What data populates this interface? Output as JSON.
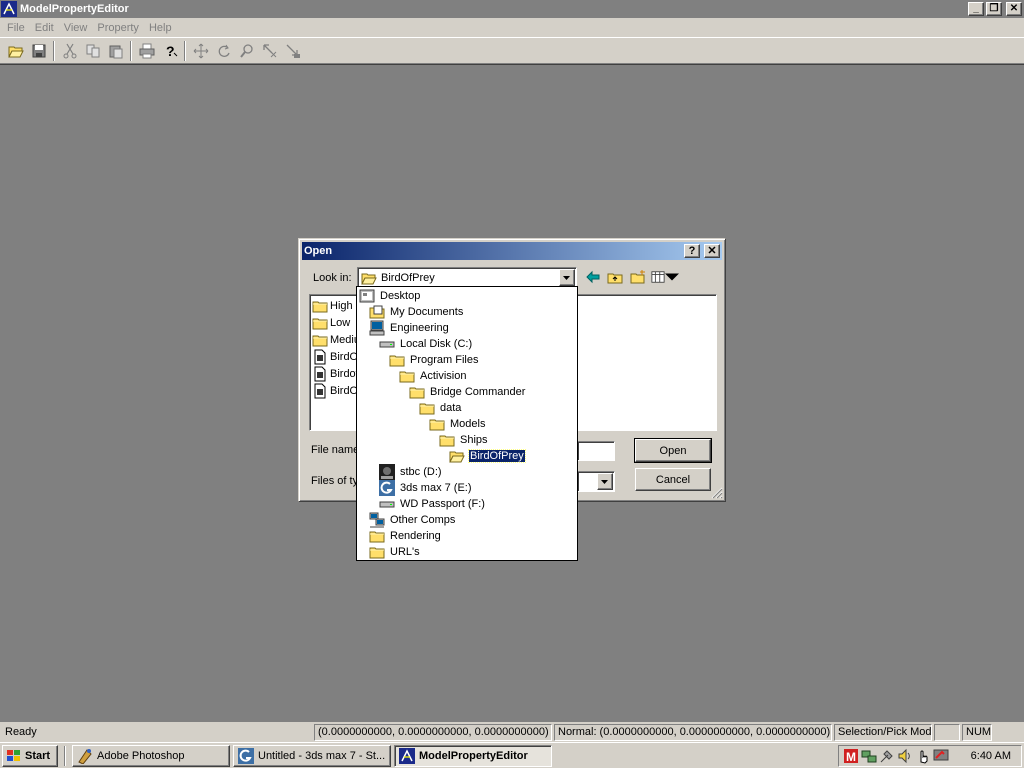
{
  "app": {
    "title": "ModelPropertyEditor",
    "menu": [
      "File",
      "Edit",
      "View",
      "Property",
      "Help"
    ],
    "window_buttons": {
      "minimize": "_",
      "restore": "❐",
      "close": "✕"
    }
  },
  "toolbar": {
    "icons": [
      "open-folder-icon",
      "save-icon",
      "cut-icon",
      "copy-icon",
      "paste-icon",
      "print-icon",
      "help-icon",
      "move-icon",
      "rotate-icon",
      "zoom-icon",
      "select-icon",
      "resize-icon"
    ]
  },
  "dialog": {
    "title": "Open",
    "help_button": "?",
    "close_button": "✕",
    "lookin_label": "Look in:",
    "lookin_value": "BirdOfPrey",
    "files": [
      {
        "name": "High",
        "type": "folder"
      },
      {
        "name": "Low",
        "type": "folder"
      },
      {
        "name": "Mediu",
        "type": "folder"
      },
      {
        "name": "BirdOf",
        "type": "file"
      },
      {
        "name": "Birdof",
        "type": "file"
      },
      {
        "name": "BirdOf",
        "type": "file"
      }
    ],
    "filename_label": "File name",
    "filetype_label": "Files of typ",
    "open_button": "Open",
    "cancel_button": "Cancel"
  },
  "dropdown": {
    "items": [
      {
        "label": "Desktop",
        "icon": "desktop-icon",
        "level": 0
      },
      {
        "label": "My Documents",
        "icon": "my-documents-icon",
        "level": 1
      },
      {
        "label": "Engineering",
        "icon": "computer-icon",
        "level": 1
      },
      {
        "label": "Local Disk (C:)",
        "icon": "drive-icon",
        "level": 2
      },
      {
        "label": "Program Files",
        "icon": "folder-icon",
        "level": 3
      },
      {
        "label": "Activision",
        "icon": "folder-icon",
        "level": 4
      },
      {
        "label": "Bridge Commander",
        "icon": "folder-icon",
        "level": 5
      },
      {
        "label": "data",
        "icon": "folder-icon",
        "level": 6
      },
      {
        "label": "Models",
        "icon": "folder-icon",
        "level": 7
      },
      {
        "label": "Ships",
        "icon": "folder-icon",
        "level": 8
      },
      {
        "label": "BirdOfPrey",
        "icon": "open-folder-icon",
        "level": 9,
        "selected": true
      },
      {
        "label": "stbc (D:)",
        "icon": "stbc-drive-icon",
        "level": 2
      },
      {
        "label": "3ds max 7 (E:)",
        "icon": "3dsmax-drive-icon",
        "level": 2
      },
      {
        "label": "WD Passport (F:)",
        "icon": "drive-icon",
        "level": 2
      },
      {
        "label": "Other Comps",
        "icon": "network-icon",
        "level": 1
      },
      {
        "label": "Rendering",
        "icon": "folder-icon",
        "level": 1
      },
      {
        "label": "URL's",
        "icon": "folder-icon",
        "level": 1
      }
    ]
  },
  "statusbar": {
    "ready": "Ready",
    "position": "(0.0000000000, 0.0000000000, 0.0000000000)",
    "normal": "Normal: (0.0000000000, 0.0000000000, 0.0000000000)",
    "mode": "Selection/Pick Mode",
    "empty": "",
    "num": "NUM"
  },
  "taskbar": {
    "start": "Start",
    "tasks": [
      {
        "label": "Adobe Photoshop",
        "icon": "photoshop-icon",
        "active": false
      },
      {
        "label": "Untitled - 3ds max 7 - St...",
        "icon": "3dsmax-icon",
        "active": false
      },
      {
        "label": "ModelPropertyEditor",
        "icon": "app-icon",
        "active": true
      }
    ],
    "clock": "6:40 AM"
  },
  "colors": {
    "desktop_gray": "#808080",
    "face": "#d4d0c8",
    "selection": "#0a246a",
    "folder": "#ffdf6b"
  }
}
